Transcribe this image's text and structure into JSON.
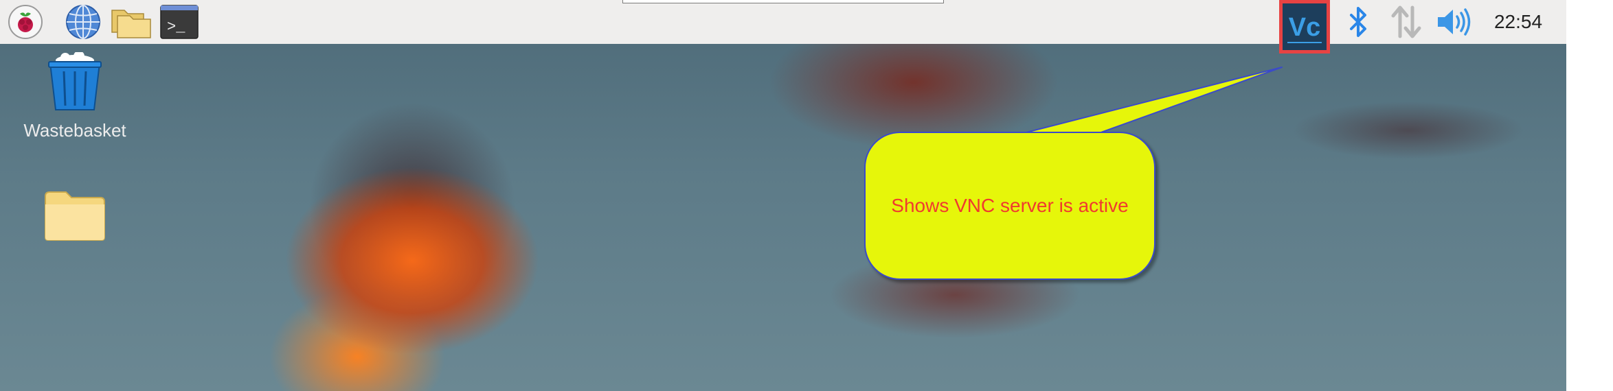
{
  "panel": {
    "menu_icon": "raspberry-pi-icon",
    "launchers": [
      {
        "name": "web-browser",
        "icon": "globe-icon"
      },
      {
        "name": "file-manager",
        "icon": "folder-icon"
      },
      {
        "name": "terminal",
        "icon": "terminal-icon",
        "glyph": ">_"
      }
    ],
    "tray": {
      "vnc_icon": "vnc-icon",
      "vnc_glyph": "Vc",
      "bluetooth_icon": "bluetooth-icon",
      "network_icon": "network-arrows-icon",
      "volume_icon": "volume-icon",
      "clock": "22:54"
    },
    "highlight_color": "#e74343"
  },
  "desktop": {
    "icons": [
      {
        "label": "Wastebasket",
        "icon": "wastebasket-icon"
      },
      {
        "label": "",
        "icon": "folder-icon"
      }
    ]
  },
  "callout": {
    "text": "Shows VNC server is active",
    "fill_color": "#e6f60a",
    "text_color": "#f03a2f"
  }
}
